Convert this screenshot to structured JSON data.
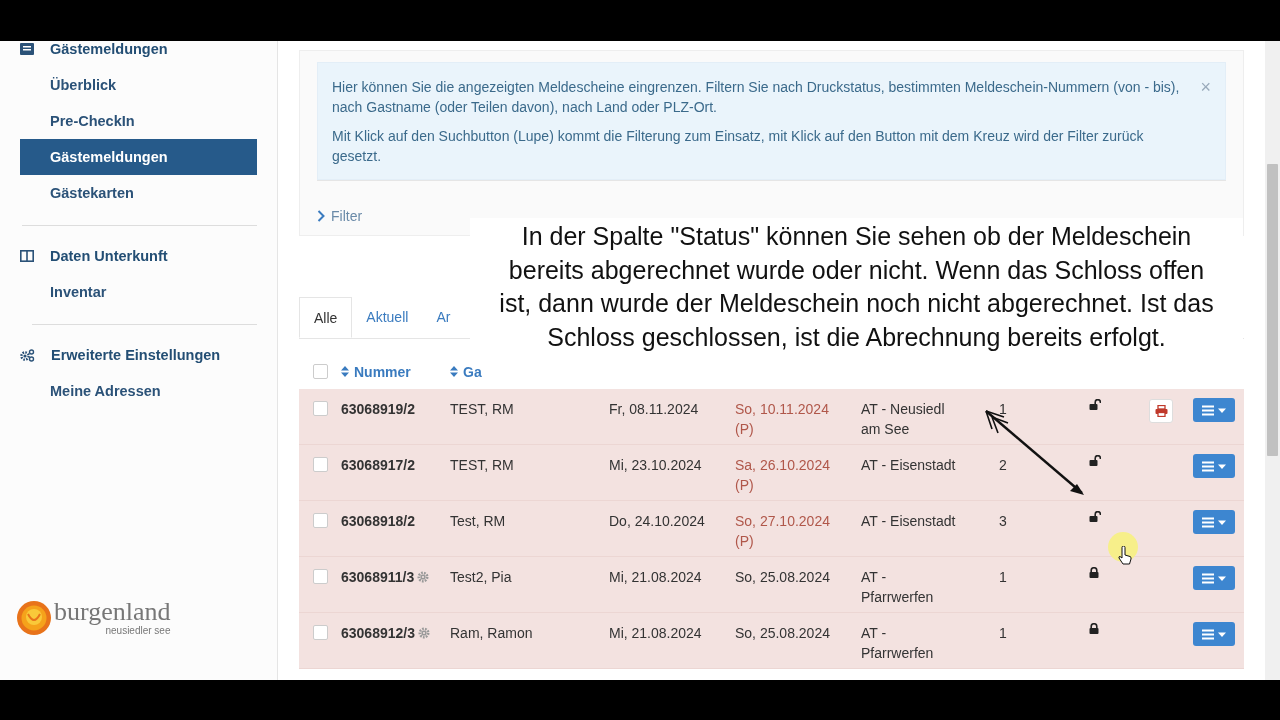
{
  "sidebar": {
    "groups": [
      {
        "title": "Gästemeldungen",
        "items": [
          {
            "label": "Überblick",
            "selected": false
          },
          {
            "label": "Pre-CheckIn",
            "selected": false
          },
          {
            "label": "Gästemeldungen",
            "selected": true
          },
          {
            "label": "Gästekarten",
            "selected": false
          }
        ]
      },
      {
        "title": "Daten Unterkunft",
        "items": [
          {
            "label": "Inventar",
            "selected": false
          }
        ]
      },
      {
        "title": "Erweiterte Einstellungen",
        "items": [
          {
            "label": "Meine Adressen",
            "selected": false
          }
        ]
      }
    ],
    "logo": {
      "name": "burgenland",
      "tagline": "neusiedler see"
    }
  },
  "info_alert": {
    "paragraphs": [
      "Hier können Sie die angezeigten Meldescheine eingrenzen. Filtern Sie nach Druckstatus, bestimmten Meldeschein-Nummern (von - bis), nach Gastname (oder Teilen davon), nach Land oder PLZ-Ort.",
      "Mit Klick auf den Suchbutton (Lupe) kommt die Filterung zum Einsatz, mit Klick auf den Button mit dem Kreuz wird der Filter zurück gesetzt."
    ],
    "close": "×"
  },
  "filter": {
    "label": "Filter",
    "expanded": false
  },
  "tabs": [
    {
      "label": "Alle",
      "selected": true
    },
    {
      "label": "Aktuell",
      "selected": false
    },
    {
      "label": "Ar",
      "selected": false
    }
  ],
  "table": {
    "select_all_checked": false,
    "columns": [
      "Nummer",
      "Ga"
    ],
    "rows": [
      {
        "checked": false,
        "number": "63068919/2",
        "gear": false,
        "name": "TEST, RM",
        "arrival": "Fr, 08.11.2024",
        "departure": "So, 10.11.2024",
        "departure_note": "(P)",
        "overdue": true,
        "place": [
          "AT - Neusiedl",
          "am See"
        ],
        "persons": "1",
        "locked": false,
        "printable": true
      },
      {
        "checked": false,
        "number": "63068917/2",
        "gear": false,
        "name": "TEST, RM",
        "arrival": "Mi, 23.10.2024",
        "departure": "Sa, 26.10.2024",
        "departure_note": "(P)",
        "overdue": true,
        "place": [
          "AT - Eisenstadt"
        ],
        "persons": "2",
        "locked": false,
        "printable": false
      },
      {
        "checked": false,
        "number": "63068918/2",
        "gear": false,
        "name": "Test, RM",
        "arrival": "Do, 24.10.2024",
        "departure": "So, 27.10.2024",
        "departure_note": "(P)",
        "overdue": true,
        "place": [
          "AT - Eisenstadt"
        ],
        "persons": "3",
        "locked": false,
        "printable": false
      },
      {
        "checked": false,
        "number": "63068911/3",
        "gear": true,
        "name": "Test2, Pia",
        "arrival": "Mi, 21.08.2024",
        "departure": "So, 25.08.2024",
        "overdue": false,
        "place": [
          "AT -",
          "Pfarrwerfen"
        ],
        "persons": "1",
        "locked": true,
        "printable": false
      },
      {
        "checked": false,
        "number": "63068912/3",
        "gear": true,
        "name": "Ram, Ramon",
        "arrival": "Mi, 21.08.2024",
        "departure": "So, 25.08.2024",
        "overdue": false,
        "place": [
          "AT -",
          "Pfarrwerfen"
        ],
        "persons": "1",
        "locked": true,
        "printable": false
      }
    ]
  },
  "caption": "In der Spalte \"Status\" können Sie sehen ob der Meldeschein bereits abgerechnet wurde oder nicht. Wenn das Schloss offen ist, dann wurde der Meldeschein noch nicht abgerechnet. Ist das Schloss geschlossen, ist die Abrechnung bereits erfolgt."
}
